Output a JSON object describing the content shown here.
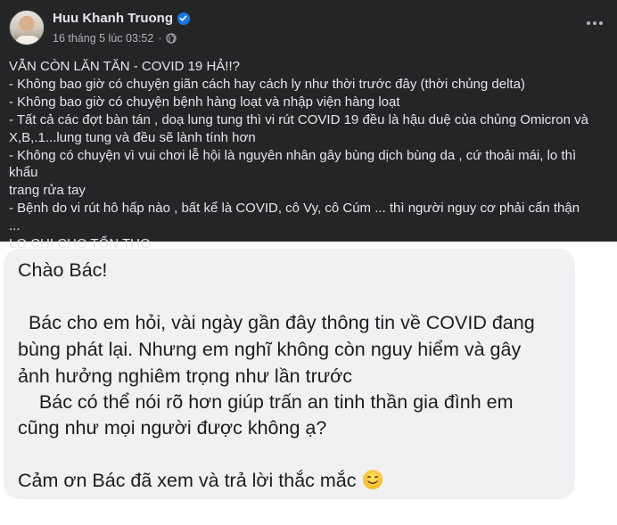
{
  "post": {
    "author": "Huu Khanh Truong",
    "timestamp": "16 tháng 5 lúc 03:52",
    "separator": "·",
    "lines": [
      "VẪN CÒN LĂN TĂN - COVID 19 HẢ!!?",
      "- Không bao giờ có chuyện giãn cách hay cách ly như thời trước đây (thời chủng delta)",
      "- Không bao giờ có chuyện bệnh hàng loạt và nhập viện hàng loạt",
      "- Tất cả các đợt bàn tán , doạ lung tung thì vi rút COVID 19 đều là hậu duệ của chủng Omicron và",
      "X,B,.1...lung tung và đều sẽ lành tính hơn",
      "- Không có chuyện vì vui chơi lễ hội là nguyên nhân gây bùng dịch bùng da , cứ thoải mái, lo thì khẩu",
      "trang rửa tay",
      "- Bệnh do vi rút hô hấp nào , bất kể là COVID, cô Vy, cô Cúm ... thì người nguy cơ phải cẩn thận",
      "...",
      "LO CHI CHO TỔN THỌ"
    ],
    "icons": {
      "verified": "verified-badge-icon",
      "audience": "globe-icon",
      "more": "more-options-icon"
    },
    "colors": {
      "background": "#242526",
      "text": "#e4e6eb",
      "muted": "#b0b3b8",
      "verified": "#1b74e4"
    }
  },
  "message": {
    "greeting": "Chào Bác!",
    "line1": "  Bác cho em hỏi, vài ngày gần đây thông tin về COVID đang",
    "line2": "bùng phát lại. Nhưng em nghĩ không còn nguy hiểm và gây",
    "line3": "ảnh hưởng nghiêm trọng như lần trước",
    "line4": "    Bác có thể nói rõ hơn giúp trấn an tinh thần gia đình em",
    "line5": "cũng như mọi người được không ạ?",
    "closing": "Cảm ơn Bác đã xem và trả lời thắc mắc",
    "emoji": "smiling-face-icon",
    "colors": {
      "background": "#f1f1f3",
      "text": "#1c1c1e"
    }
  }
}
